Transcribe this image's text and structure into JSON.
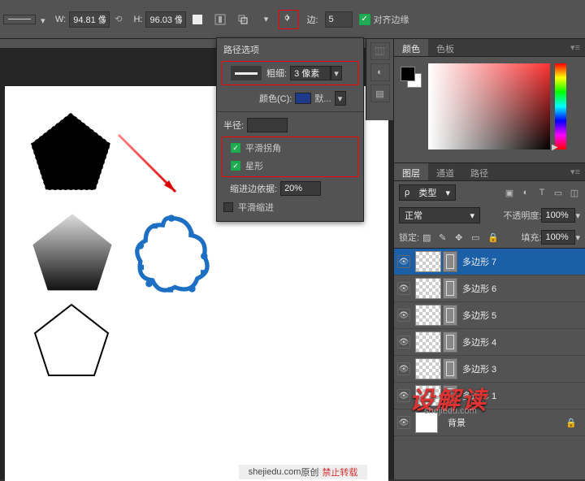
{
  "topbar": {
    "w_label": "W:",
    "w_value": "94.81 像",
    "h_label": "H:",
    "h_value": "96.03 像",
    "sides_label": "边:",
    "sides_value": "5",
    "align_label": "对齐边缘"
  },
  "popup": {
    "title": "路径选项",
    "thickness_label": "粗细:",
    "thickness_value": "3 像素",
    "color_label": "颜色(C):",
    "color_value": "默...",
    "radius_label": "半径:",
    "radius_value": "",
    "smooth_corners": "平滑拐角",
    "star": "星形",
    "indent_label": "缩进边依据:",
    "indent_value": "20%",
    "smooth_indent": "平滑缩进"
  },
  "watermark": {
    "site": "shejiedu.com",
    "orig": "原创",
    "noredist": "禁止转载",
    "brand": "设解读",
    "brand_sub": "shejiedu.com"
  },
  "color_panel": {
    "tab_color": "颜色",
    "tab_swatch": "色板"
  },
  "layers_panel": {
    "tab_layers": "图层",
    "tab_channels": "通道",
    "tab_paths": "路径",
    "type_icon": "ρ",
    "type_label": "类型",
    "blend_mode": "正常",
    "opacity_label": "不透明度:",
    "opacity_value": "100%",
    "lock_label": "锁定:",
    "fill_label": "填充:",
    "fill_value": "100%",
    "layers": [
      {
        "name": "多边形 7",
        "selected": true
      },
      {
        "name": "多边形 6",
        "selected": false
      },
      {
        "name": "多边形 5",
        "selected": false
      },
      {
        "name": "多边形 4",
        "selected": false
      },
      {
        "name": "多边形 3",
        "selected": false
      },
      {
        "name": "多边形 1",
        "selected": false
      }
    ],
    "bg_layer": "背景"
  }
}
